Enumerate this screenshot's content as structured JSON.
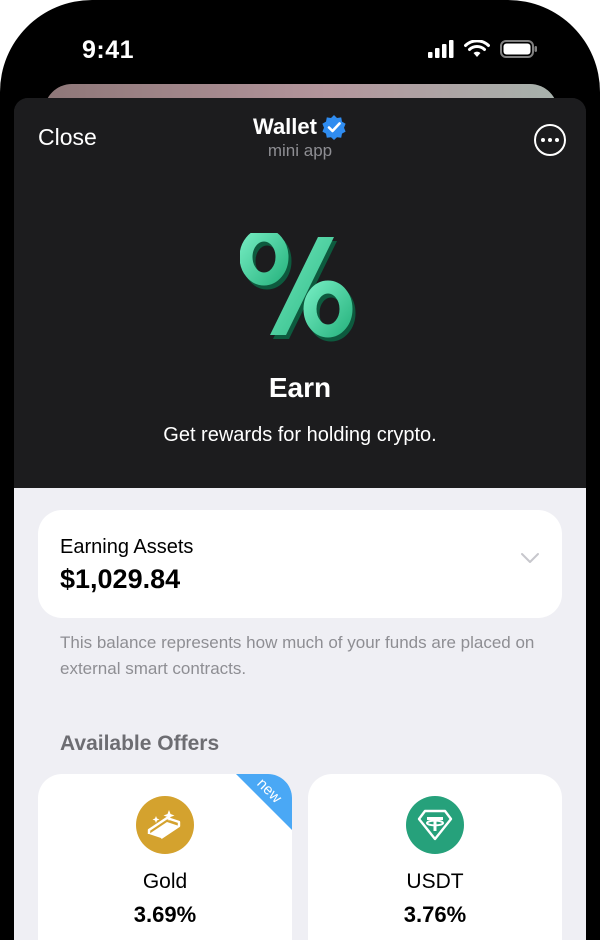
{
  "status_bar": {
    "time": "9:41"
  },
  "header": {
    "close_label": "Close",
    "title": "Wallet",
    "subtitle": "mini app",
    "earn_title": "Earn",
    "earn_subtitle": "Get rewards for holding crypto."
  },
  "assets": {
    "label": "Earning Assets",
    "value": "$1,029.84",
    "note": "This balance represents how much of your funds are placed on external smart contracts."
  },
  "offers": {
    "heading": "Available Offers",
    "items": [
      {
        "name": "Gold",
        "rate": "3.69%",
        "badge": "new",
        "icon": "gold-bar-icon",
        "color": "#d4a22e"
      },
      {
        "name": "USDT",
        "rate": "3.76%",
        "icon": "tether-icon",
        "color": "#26a17b"
      }
    ]
  },
  "colors": {
    "accent": "#4cd6a2",
    "verified": "#2f8cf0",
    "ribbon": "#4aa8f5"
  }
}
